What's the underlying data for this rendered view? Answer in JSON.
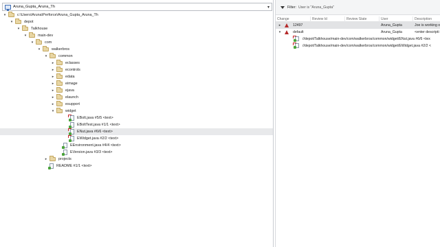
{
  "workspace": {
    "name": "Aruna_Gupta_Aruna_Th"
  },
  "tree": [
    {
      "label": "c:\\Users\\Aruna\\Perforce\\Aruna_Gupta_Aruna_Th",
      "indent": 0,
      "twisty": "expanded",
      "icon": "folder"
    },
    {
      "label": "depot",
      "indent": 1,
      "twisty": "expanded",
      "icon": "folder"
    },
    {
      "label": "Talkhouse",
      "indent": 2,
      "twisty": "expanded",
      "icon": "folder"
    },
    {
      "label": "main-dev",
      "indent": 3,
      "twisty": "expanded",
      "icon": "folder"
    },
    {
      "label": "com",
      "indent": 4,
      "twisty": "expanded",
      "icon": "folder"
    },
    {
      "label": "walkerbros",
      "indent": 5,
      "twisty": "expanded",
      "icon": "folder"
    },
    {
      "label": "common",
      "indent": 6,
      "twisty": "expanded",
      "icon": "folder"
    },
    {
      "label": "eclasses",
      "indent": 7,
      "twisty": "collapsed",
      "icon": "folder"
    },
    {
      "label": "econtrols",
      "indent": 7,
      "twisty": "collapsed",
      "icon": "folder"
    },
    {
      "label": "edata",
      "indent": 7,
      "twisty": "collapsed",
      "icon": "folder"
    },
    {
      "label": "eimage",
      "indent": 7,
      "twisty": "collapsed",
      "icon": "folder"
    },
    {
      "label": "ejava",
      "indent": 7,
      "twisty": "collapsed",
      "icon": "folder"
    },
    {
      "label": "elaunch",
      "indent": 7,
      "twisty": "collapsed",
      "icon": "folder"
    },
    {
      "label": "esupport",
      "indent": 7,
      "twisty": "collapsed",
      "icon": "folder"
    },
    {
      "label": "widget",
      "indent": 7,
      "twisty": "expanded",
      "icon": "folder"
    },
    {
      "label": "EBolt.java #5/5 <text>",
      "indent": 9,
      "twisty": "none",
      "icon": "file-checkout"
    },
    {
      "label": "EBoltTest.java #1/1 <text>",
      "indent": 9,
      "twisty": "none",
      "icon": "file"
    },
    {
      "label": "ENut.java #6/6 <text>",
      "indent": 9,
      "twisty": "none",
      "icon": "file-checkout",
      "selected": true
    },
    {
      "label": "EWidget.java #2/2 <text>",
      "indent": 9,
      "twisty": "none",
      "icon": "file-checkout"
    },
    {
      "label": "EEnvironment.java #4/4 <text>",
      "indent": 8,
      "twisty": "none",
      "icon": "file"
    },
    {
      "label": "EVersion.java #3/3 <text>",
      "indent": 8,
      "twisty": "none",
      "icon": "file"
    },
    {
      "label": "projects",
      "indent": 6,
      "twisty": "collapsed",
      "icon": "folder"
    },
    {
      "label": "README #1/1 <text>",
      "indent": 6,
      "twisty": "none",
      "icon": "file"
    }
  ],
  "filter": {
    "label": "Filter:",
    "value": "User is \"Aruna_Gupta\""
  },
  "columns": [
    "Change",
    "Review Id",
    "Review State",
    "User",
    "Description"
  ],
  "changelists": [
    {
      "id": "12497",
      "user": "Aruna_Gupta",
      "description": "Joe is working o",
      "twisty": "collapsed",
      "selected": true
    },
    {
      "id": "default",
      "user": "Aruna_Gupta",
      "description": "<enter descripti",
      "twisty": "expanded",
      "selected": false
    }
  ],
  "changelist_files": [
    "//depot/Talkhouse/main-dev/com/walkerbros/common/widget/ENut.java #6/6 <tex",
    "//depot/Talkhouse/main-dev/com/walkerbros/common/widget/EWidget.java #2/2 <"
  ],
  "colors": {
    "pending": "#b52a2a",
    "folder": "#e8d6a4",
    "synced": "#4aa33a",
    "selection": "#e2e3e5"
  }
}
